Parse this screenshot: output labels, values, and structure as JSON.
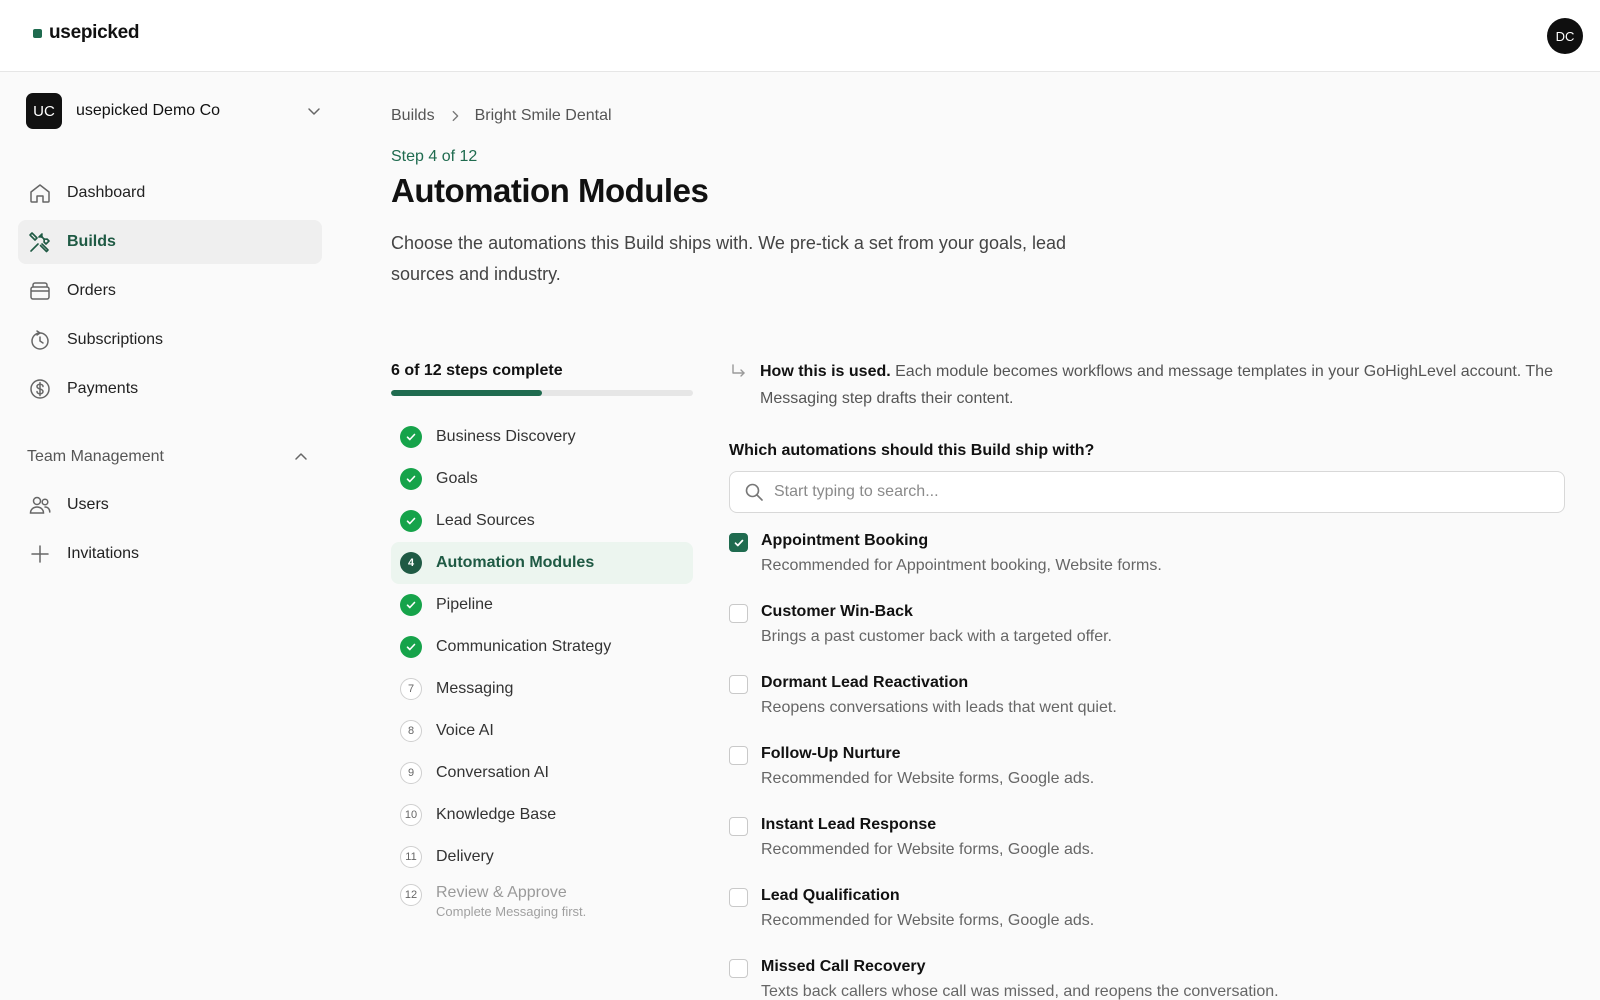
{
  "app": {
    "logo": "usepicked",
    "user_initials": "DC"
  },
  "org": {
    "initials": "UC",
    "name": "usepicked Demo Co"
  },
  "nav": [
    {
      "label": "Dashboard",
      "icon": "home-icon",
      "active": false
    },
    {
      "label": "Builds",
      "icon": "tools-icon",
      "active": true
    },
    {
      "label": "Orders",
      "icon": "box-icon",
      "active": false
    },
    {
      "label": "Subscriptions",
      "icon": "refresh-icon",
      "active": false
    },
    {
      "label": "Payments",
      "icon": "dollar-icon",
      "active": false
    }
  ],
  "team": {
    "label": "Team Management",
    "items": [
      {
        "label": "Users",
        "icon": "users-icon"
      },
      {
        "label": "Invitations",
        "icon": "plus-icon"
      }
    ]
  },
  "breadcrumb": [
    "Builds",
    "Bright Smile Dental"
  ],
  "step_label": "Step 4 of 12",
  "title": "Automation Modules",
  "description": "Choose the automations this Build ships with. We pre-tick a set from your goals, lead sources and industry.",
  "progress": {
    "label": "6 of 12 steps complete",
    "completed": 6,
    "total": 12
  },
  "steps": [
    {
      "n": "1",
      "label": "Business Discovery",
      "state": "done"
    },
    {
      "n": "2",
      "label": "Goals",
      "state": "done"
    },
    {
      "n": "3",
      "label": "Lead Sources",
      "state": "done"
    },
    {
      "n": "4",
      "label": "Automation Modules",
      "state": "current"
    },
    {
      "n": "5",
      "label": "Pipeline",
      "state": "done"
    },
    {
      "n": "6",
      "label": "Communication Strategy",
      "state": "done"
    },
    {
      "n": "7",
      "label": "Messaging",
      "state": "todo"
    },
    {
      "n": "8",
      "label": "Voice AI",
      "state": "todo"
    },
    {
      "n": "9",
      "label": "Conversation AI",
      "state": "todo"
    },
    {
      "n": "10",
      "label": "Knowledge Base",
      "state": "todo"
    },
    {
      "n": "11",
      "label": "Delivery",
      "state": "todo"
    },
    {
      "n": "12",
      "label": "Review & Approve",
      "state": "disabled",
      "sub": "Complete Messaging first."
    }
  ],
  "info": {
    "bold": "How this is used.",
    "text": " Each module becomes workflows and message templates in your GoHighLevel account. The Messaging step drafts their content."
  },
  "question": "Which automations should this Build ship with?",
  "search": {
    "placeholder": "Start typing to search..."
  },
  "modules": [
    {
      "title": "Appointment Booking",
      "desc": "Recommended for Appointment booking, Website forms.",
      "checked": true
    },
    {
      "title": "Customer Win-Back",
      "desc": "Brings a past customer back with a targeted offer.",
      "checked": false
    },
    {
      "title": "Dormant Lead Reactivation",
      "desc": "Reopens conversations with leads that went quiet.",
      "checked": false
    },
    {
      "title": "Follow-Up Nurture",
      "desc": "Recommended for Website forms, Google ads.",
      "checked": false
    },
    {
      "title": "Instant Lead Response",
      "desc": "Recommended for Website forms, Google ads.",
      "checked": false
    },
    {
      "title": "Lead Qualification",
      "desc": "Recommended for Website forms, Google ads.",
      "checked": false
    },
    {
      "title": "Missed Call Recovery",
      "desc": "Texts back callers whose call was missed, and reopens the conversation.",
      "checked": false
    }
  ],
  "colors": {
    "accent": "#1f6b4f",
    "done": "#16a34a",
    "active_bg": "#ecf5ef"
  }
}
